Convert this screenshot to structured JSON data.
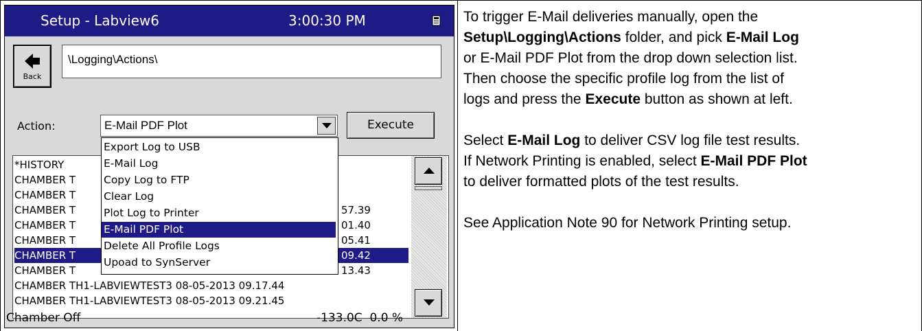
{
  "window": {
    "title": "Setup - Labview6",
    "time": "3:00:30 PM"
  },
  "back_button": {
    "label": "Back"
  },
  "path": {
    "value": "\\Logging\\Actions\\"
  },
  "action": {
    "label": "Action:",
    "selected": "E-Mail PDF Plot",
    "execute_label": "Execute"
  },
  "dropdown": {
    "items": [
      "Export Log to USB",
      "E-Mail Log",
      "Copy Log to FTP",
      "Clear Log",
      "Plot Log to Printer",
      "E-Mail PDF Plot",
      "Delete All Profile Logs",
      "Upoad to SynServer"
    ],
    "selected_index": 5
  },
  "log_list": {
    "rows": [
      "*HISTORY",
      "CHAMBER T",
      "CHAMBER T",
      "CHAMBER T",
      "CHAMBER T",
      "CHAMBER T",
      "CHAMBER T",
      "CHAMBER T",
      "CHAMBER TH1-LABVIEWTEST3 08-05-2013 09.17.44",
      "CHAMBER TH1-LABVIEWTEST3 08-05-2013 09.21.45"
    ],
    "row_tails": [
      "",
      "",
      "",
      "57.39",
      "01.40",
      "05.41",
      "09.42",
      "13.43",
      "",
      ""
    ],
    "selected_index": 6
  },
  "status": {
    "left": "Chamber Off",
    "temperature": "-133.0C",
    "percent": "0.0 %"
  },
  "doc": {
    "p1_a": "To trigger E-Mail deliveries manually, open the",
    "p1_b_bold": "Setup\\Logging\\Actions",
    "p1_c": " folder, and pick ",
    "p1_d_bold": "E-Mail Log",
    "p1_e": "or E-Mail PDF Plot from the drop down selection list.",
    "p1_f": "Then choose the specific profile log from the list of",
    "p1_g": "logs and press the ",
    "p1_h_bold": "Execute",
    "p1_i": " button as shown at left.",
    "p2_a": "Select ",
    "p2_b_bold": "E-Mail Log",
    "p2_c": " to deliver CSV log file test results.",
    "p2_d": "If Network Printing is enabled, select ",
    "p2_e_bold": "E-Mail PDF Plot",
    "p2_f": "to deliver formatted plots of the test results.",
    "p3": "See Application Note 90 for Network Printing setup."
  },
  "colors": {
    "titlebar": "#1f1b86",
    "selection": "#1f1b86",
    "device_bg": "#d9d9d9"
  },
  "icons": [
    "back-arrow-icon",
    "dropdown-arrow-icon",
    "scroll-up-icon",
    "scroll-down-icon",
    "window-icon"
  ]
}
